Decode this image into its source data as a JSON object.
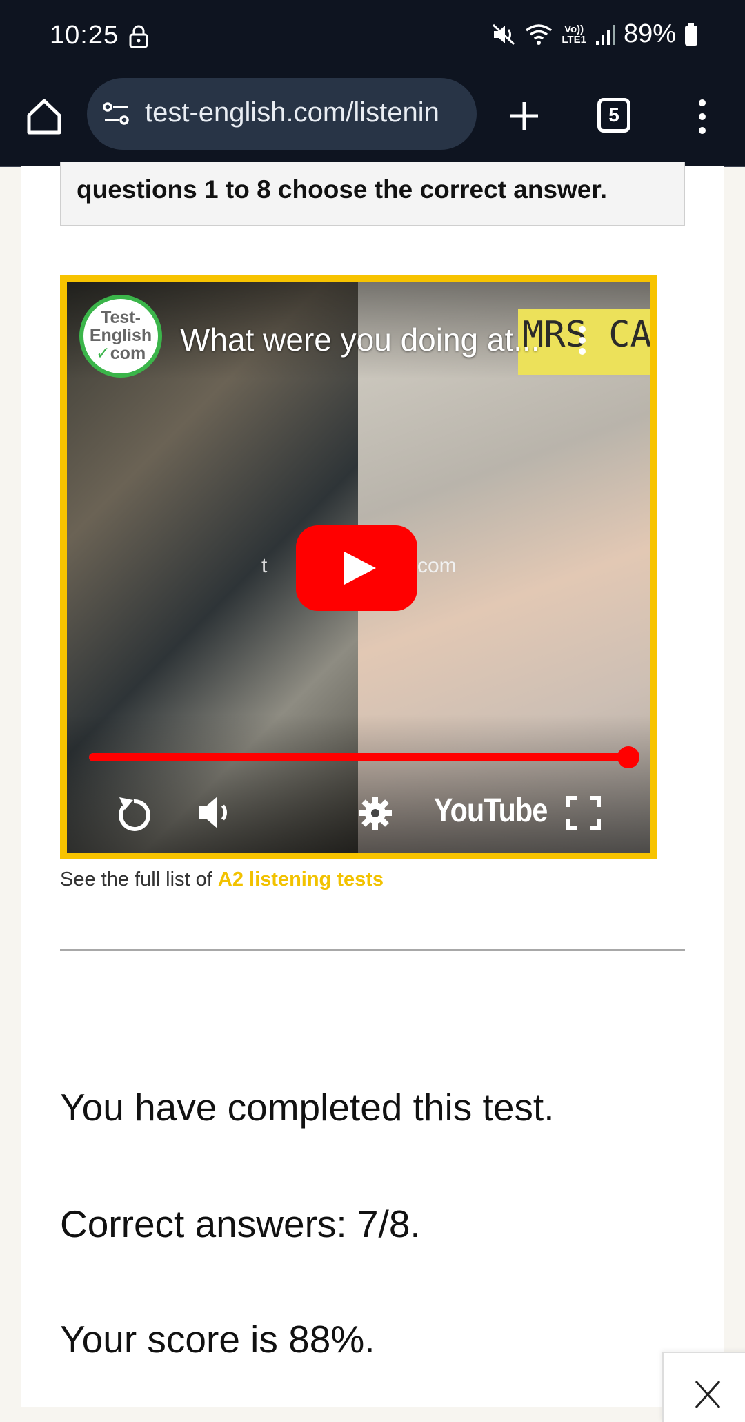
{
  "status_bar": {
    "time": "10:25",
    "volte_top": "Vo))",
    "volte_bottom": "LTE1",
    "battery": "89%"
  },
  "browser": {
    "url": "test-english.com/listenin",
    "tab_count": "5"
  },
  "page": {
    "instructions_text": "questions 1 to 8 choose the correct answer.",
    "video": {
      "channel_logo_line1": "Test-",
      "channel_logo_line2": "English",
      "channel_logo_line3": "com",
      "title": "What were you doing at...",
      "sticky_note_text": "MRS CA",
      "watermark_left": "t",
      "watermark_right": "com",
      "youtube_wordmark": "YouTube",
      "progress_fraction": 1.0,
      "accent_color": "#f7c300",
      "progress_color": "#ff0000"
    },
    "caption_prefix": "See the full list of ",
    "caption_link": "A2 listening tests",
    "result_completed": "You have completed this test.",
    "result_correct": "Correct answers: 7/8.",
    "result_score": "Your score is 88%."
  },
  "close_button_icon": "close-x-icon"
}
